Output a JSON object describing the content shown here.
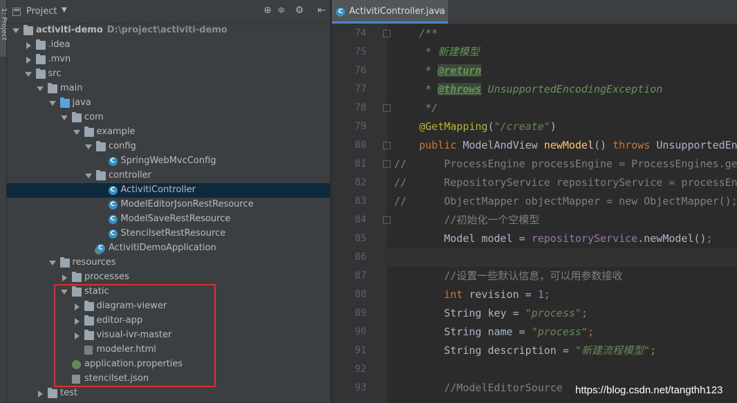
{
  "stripe": {
    "label": "1: Project"
  },
  "project": {
    "title": "Project",
    "tree": [
      {
        "label": "activiti-demo",
        "path": "D:\\project\\activiti-demo",
        "depth": 0,
        "arrow": "open",
        "icon": "module-folder-icon",
        "bold": true
      },
      {
        "label": ".idea",
        "depth": 1,
        "arrow": "closed",
        "icon": "folder-icon"
      },
      {
        "label": ".mvn",
        "depth": 1,
        "arrow": "closed",
        "icon": "folder-icon"
      },
      {
        "label": "src",
        "depth": 1,
        "arrow": "open",
        "icon": "folder-icon"
      },
      {
        "label": "main",
        "depth": 2,
        "arrow": "open",
        "icon": "folder-icon"
      },
      {
        "label": "java",
        "depth": 3,
        "arrow": "open",
        "icon": "source-folder-icon"
      },
      {
        "label": "com",
        "depth": 4,
        "arrow": "open",
        "icon": "package-icon"
      },
      {
        "label": "example",
        "depth": 5,
        "arrow": "open",
        "icon": "package-icon"
      },
      {
        "label": "config",
        "depth": 6,
        "arrow": "open",
        "icon": "package-icon"
      },
      {
        "label": "SpringWebMvcConfig",
        "depth": 7,
        "arrow": "",
        "icon": "class-icon"
      },
      {
        "label": "controller",
        "depth": 6,
        "arrow": "open",
        "icon": "package-icon"
      },
      {
        "label": "ActivitiController",
        "depth": 7,
        "arrow": "",
        "icon": "class-icon",
        "selected": true
      },
      {
        "label": "ModelEditorJsonRestResource",
        "depth": 7,
        "arrow": "",
        "icon": "class-icon"
      },
      {
        "label": "ModelSaveRestResource",
        "depth": 7,
        "arrow": "",
        "icon": "class-icon"
      },
      {
        "label": "StencilsetRestResource",
        "depth": 7,
        "arrow": "",
        "icon": "class-icon"
      },
      {
        "label": "ActivitiDemoApplication",
        "depth": 6,
        "arrow": "",
        "icon": "spring-boot-class-icon"
      },
      {
        "label": "resources",
        "depth": 3,
        "arrow": "open",
        "icon": "resources-folder-icon"
      },
      {
        "label": "processes",
        "depth": 4,
        "arrow": "closed",
        "icon": "folder-icon"
      },
      {
        "label": "static",
        "depth": 4,
        "arrow": "open",
        "icon": "folder-icon"
      },
      {
        "label": "diagram-viewer",
        "depth": 5,
        "arrow": "closed",
        "icon": "folder-icon"
      },
      {
        "label": "editor-app",
        "depth": 5,
        "arrow": "closed",
        "icon": "folder-icon"
      },
      {
        "label": "visual-ivr-master",
        "depth": 5,
        "arrow": "closed",
        "icon": "folder-icon"
      },
      {
        "label": "modeler.html",
        "depth": 5,
        "arrow": "",
        "icon": "html-file-icon"
      },
      {
        "label": "application.properties",
        "depth": 4,
        "arrow": "",
        "icon": "properties-file-icon"
      },
      {
        "label": "stencilset.json",
        "depth": 4,
        "arrow": "",
        "icon": "json-file-icon"
      },
      {
        "label": "test",
        "depth": 2,
        "arrow": "closed",
        "icon": "folder-icon"
      }
    ]
  },
  "editor": {
    "tab_label": "ActivitiController.java",
    "lines": [
      {
        "n": "74",
        "fold": true,
        "segs": [
          {
            "t": "    ",
            "c": ""
          },
          {
            "t": "/**",
            "c": "c-doc"
          }
        ]
      },
      {
        "n": "75",
        "segs": [
          {
            "t": "     ",
            "c": ""
          },
          {
            "t": "* 新建模型",
            "c": "c-doc"
          }
        ]
      },
      {
        "n": "76",
        "segs": [
          {
            "t": "     ",
            "c": ""
          },
          {
            "t": "* ",
            "c": "c-doc"
          },
          {
            "t": "@return",
            "c": "c-tag"
          }
        ]
      },
      {
        "n": "77",
        "segs": [
          {
            "t": "     ",
            "c": ""
          },
          {
            "t": "* ",
            "c": "c-doc"
          },
          {
            "t": "@throws",
            "c": "c-tag"
          },
          {
            "t": " UnsupportedEncodingException",
            "c": "c-doc"
          }
        ]
      },
      {
        "n": "78",
        "fold": true,
        "segs": [
          {
            "t": "     ",
            "c": ""
          },
          {
            "t": "*/",
            "c": "c-doc"
          }
        ]
      },
      {
        "n": "79",
        "segs": [
          {
            "t": "    ",
            "c": ""
          },
          {
            "t": "@GetMapping",
            "c": "c-ann"
          },
          {
            "t": "(",
            "c": ""
          },
          {
            "t": "\"/create\"",
            "c": "c-str"
          },
          {
            "t": ")",
            "c": ""
          }
        ]
      },
      {
        "n": "80",
        "fold": true,
        "segs": [
          {
            "t": "    ",
            "c": ""
          },
          {
            "t": "public ",
            "c": "c-kw"
          },
          {
            "t": "ModelAndView ",
            "c": ""
          },
          {
            "t": "newModel",
            "c": "c-fn"
          },
          {
            "t": "() ",
            "c": ""
          },
          {
            "t": "throws ",
            "c": "c-kw"
          },
          {
            "t": "UnsupportedEncodingException",
            "c": ""
          }
        ]
      },
      {
        "n": "81",
        "fold": true,
        "segs": [
          {
            "t": "//      ProcessEngine processEngine = ProcessEngines.getDefaultProcessEngine();",
            "c": "c-cmt"
          }
        ]
      },
      {
        "n": "82",
        "segs": [
          {
            "t": "//      RepositoryService repositoryService = processEngine.getRepositoryService();",
            "c": "c-cmt"
          }
        ]
      },
      {
        "n": "83",
        "segs": [
          {
            "t": "//      ObjectMapper objectMapper = new ObjectMapper();",
            "c": "c-cmt"
          }
        ]
      },
      {
        "n": "84",
        "fold": true,
        "segs": [
          {
            "t": "        ",
            "c": ""
          },
          {
            "t": "//初始化一个空模型",
            "c": "c-cmt"
          }
        ]
      },
      {
        "n": "85",
        "segs": [
          {
            "t": "        Model model = ",
            "c": ""
          },
          {
            "t": "repositoryService",
            "c": "c-fld"
          },
          {
            "t": ".newModel()",
            "c": ""
          },
          {
            "t": ";",
            "c": "c-kw"
          }
        ]
      },
      {
        "n": "86",
        "cur": true,
        "segs": []
      },
      {
        "n": "87",
        "segs": [
          {
            "t": "        ",
            "c": ""
          },
          {
            "t": "//设置一些默认信息，可以用参数接收",
            "c": "c-cmt"
          }
        ]
      },
      {
        "n": "88",
        "segs": [
          {
            "t": "        ",
            "c": ""
          },
          {
            "t": "int ",
            "c": "c-kw"
          },
          {
            "t": "revision = ",
            "c": ""
          },
          {
            "t": "1",
            "c": "c-num"
          },
          {
            "t": ";",
            "c": "c-kw"
          }
        ]
      },
      {
        "n": "89",
        "segs": [
          {
            "t": "        String key = ",
            "c": ""
          },
          {
            "t": "\"process\"",
            "c": "c-str"
          },
          {
            "t": ";",
            "c": "c-kw"
          }
        ]
      },
      {
        "n": "90",
        "segs": [
          {
            "t": "        String name = ",
            "c": ""
          },
          {
            "t": "\"process\"",
            "c": "c-str"
          },
          {
            "t": ";",
            "c": "c-kw"
          }
        ]
      },
      {
        "n": "91",
        "segs": [
          {
            "t": "        String description = ",
            "c": ""
          },
          {
            "t": "\"新建流程模型\"",
            "c": "c-str"
          },
          {
            "t": ";",
            "c": "c-kw"
          }
        ]
      },
      {
        "n": "92",
        "segs": []
      },
      {
        "n": "93",
        "segs": [
          {
            "t": "        ",
            "c": ""
          },
          {
            "t": "//ModelEditorSource",
            "c": "c-cmt"
          }
        ]
      }
    ]
  },
  "watermark": "https://blog.csdn.net/tangthh123"
}
